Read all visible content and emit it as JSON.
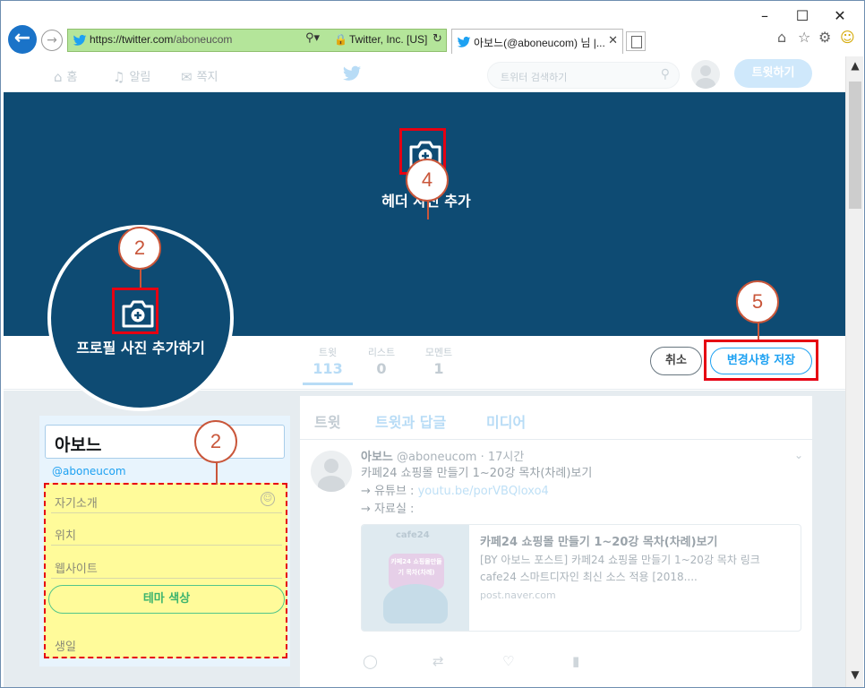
{
  "browser": {
    "url_prefix": "https://twitter.com",
    "url_path": "/aboneucom",
    "cert": "Twitter, Inc. [US]",
    "tab_title": "아보느(@aboneucom) 님 |...",
    "window_controls": [
      "–",
      "☐",
      "✕"
    ]
  },
  "twitter_nav": {
    "home": "홈",
    "notifications": "알림",
    "messages": "쪽지",
    "search_placeholder": "트위터 검색하기",
    "tweet_button": "트윗하기"
  },
  "header": {
    "add_header_label": "헤더 사진 추가",
    "add_profile_label": "프로필 사진 추가하기"
  },
  "callouts": [
    "2",
    "4",
    "5",
    "2"
  ],
  "stats": [
    {
      "label": "트윗",
      "value": "113"
    },
    {
      "label": "리스트",
      "value": "0"
    },
    {
      "label": "모멘트",
      "value": "1"
    }
  ],
  "buttons": {
    "cancel": "취소",
    "save": "변경사항 저장"
  },
  "profile_form": {
    "name": "아보느",
    "handle": "@aboneucom",
    "bio_placeholder": "자기소개",
    "location_placeholder": "위치",
    "website_placeholder": "웹사이트",
    "theme_color": "테마 색상",
    "birthday": "생일"
  },
  "timeline": {
    "tabs": [
      "트윗",
      "트윗과 답글",
      "미디어"
    ],
    "tweet": {
      "name": "아보느",
      "handle_time": "@aboneucom · 17시간",
      "text1": "카페24 쇼핑몰 만들기 1~20강 목차(차례)보기",
      "text2_prefix": "→ 유튜브 : ",
      "text2_link": "youtu.be/porVBQloxo4",
      "text3": "→ 자료실 :",
      "card_title": "카페24 쇼핑몰 만들기 1~20강 목차(차례)보기",
      "card_desc": "[BY 아보느 포스트] 카페24 쇼핑몰 만들기 1~20강 목차 링크cafe24 스마트디자인 최신 소스 적용 [2018....",
      "card_domain": "post.naver.com",
      "card_image_brand": "cafe24",
      "card_image_text": "카페24 쇼핑몰만들기 목차(차례)"
    }
  },
  "colors": {
    "header_bg": "#0e4b73",
    "highlight": "#e60012",
    "callout": "#c9563a",
    "twitter_blue": "#1da1f2",
    "form_yellow": "#fffb9a"
  }
}
